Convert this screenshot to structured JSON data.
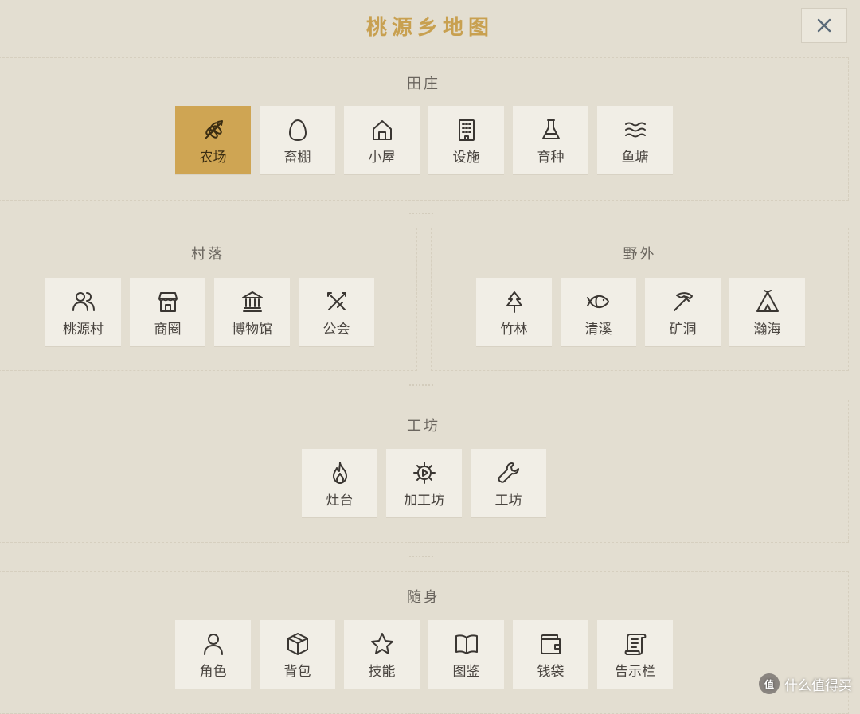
{
  "title": "桃源乡地图",
  "close_label": "×",
  "sections": {
    "tianzhuang": {
      "title": "田庄",
      "items": [
        {
          "label": "农场",
          "icon": "wheat-icon",
          "active": true
        },
        {
          "label": "畜棚",
          "icon": "egg-icon"
        },
        {
          "label": "小屋",
          "icon": "house-icon"
        },
        {
          "label": "设施",
          "icon": "building-icon"
        },
        {
          "label": "育种",
          "icon": "flask-icon"
        },
        {
          "label": "鱼塘",
          "icon": "waves-icon"
        }
      ]
    },
    "cunluo": {
      "title": "村落",
      "items": [
        {
          "label": "桃源村",
          "icon": "users-icon"
        },
        {
          "label": "商圈",
          "icon": "store-icon"
        },
        {
          "label": "博物馆",
          "icon": "museum-icon"
        },
        {
          "label": "公会",
          "icon": "swords-icon"
        }
      ]
    },
    "yewai": {
      "title": "野外",
      "items": [
        {
          "label": "竹林",
          "icon": "tree-icon"
        },
        {
          "label": "清溪",
          "icon": "fish-icon"
        },
        {
          "label": "矿洞",
          "icon": "pickaxe-icon"
        },
        {
          "label": "瀚海",
          "icon": "tent-icon"
        }
      ]
    },
    "gongfang": {
      "title": "工坊",
      "items": [
        {
          "label": "灶台",
          "icon": "flame-icon"
        },
        {
          "label": "加工坊",
          "icon": "gear-icon"
        },
        {
          "label": "工坊",
          "icon": "wrench-icon"
        }
      ]
    },
    "suishen": {
      "title": "随身",
      "items": [
        {
          "label": "角色",
          "icon": "user-icon"
        },
        {
          "label": "背包",
          "icon": "box-icon"
        },
        {
          "label": "技能",
          "icon": "star-icon"
        },
        {
          "label": "图鉴",
          "icon": "book-icon"
        },
        {
          "label": "钱袋",
          "icon": "wallet-icon"
        },
        {
          "label": "告示栏",
          "icon": "scroll-icon"
        }
      ]
    }
  },
  "watermark": {
    "badge": "值",
    "text": "什么值得买"
  },
  "colors": {
    "background": "#e3ded1",
    "accent": "#cfa553",
    "title": "#c8a050",
    "tile": "#f1eee6"
  }
}
